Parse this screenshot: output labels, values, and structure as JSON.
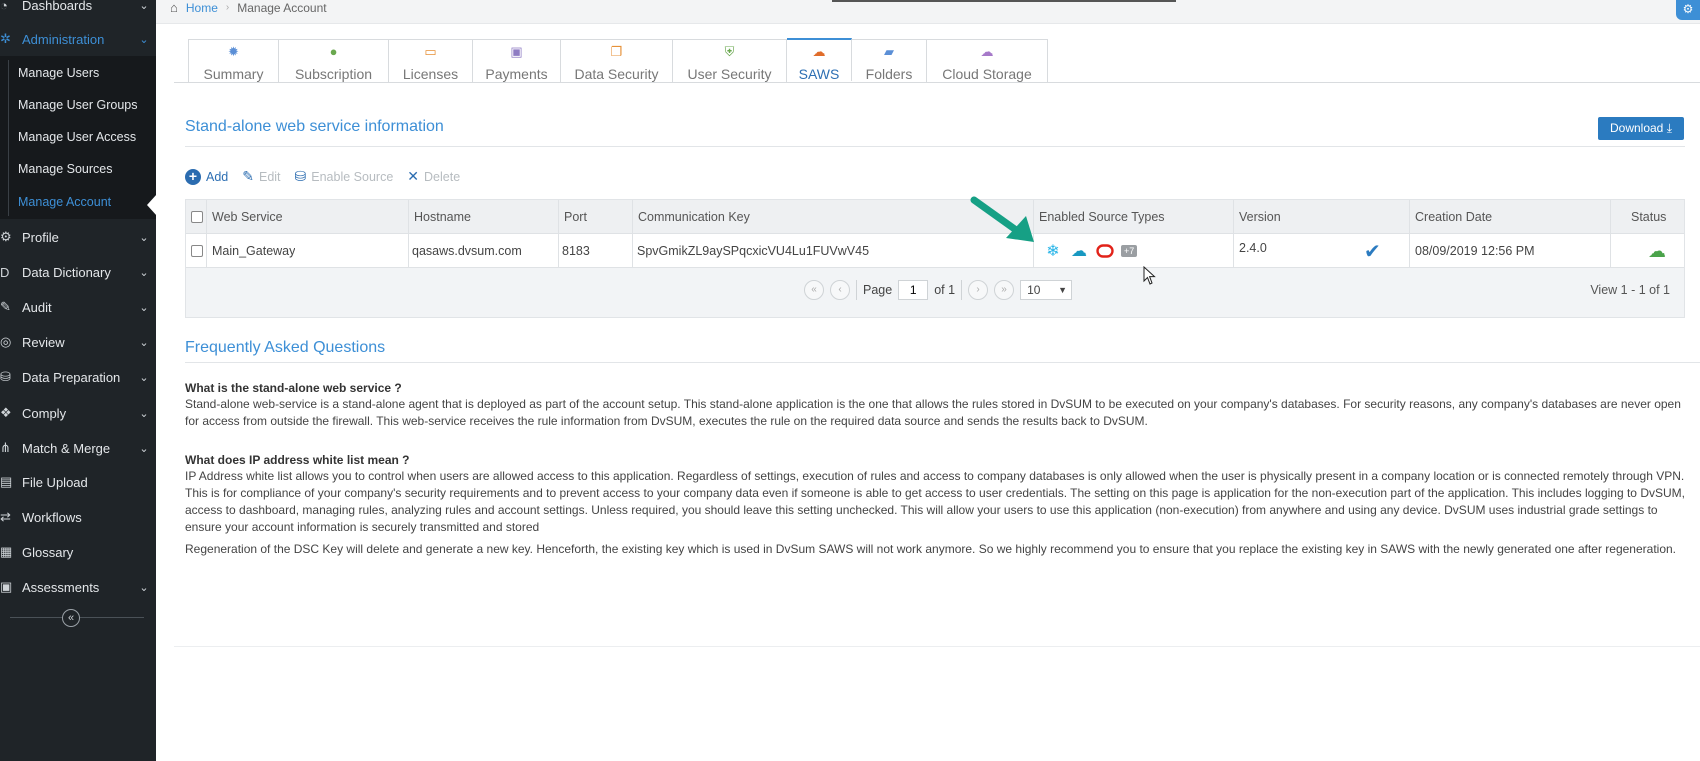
{
  "sidebar": {
    "items": [
      {
        "label": "Dashboards",
        "icon": "dashboard-icon"
      },
      {
        "label": "Administration",
        "icon": "network-icon"
      },
      {
        "label": "Profile",
        "icon": "gear-icon"
      },
      {
        "label": "Data Dictionary",
        "icon": "dictionary-icon"
      },
      {
        "label": "Audit",
        "icon": "pencil-icon"
      },
      {
        "label": "Review",
        "icon": "review-icon"
      },
      {
        "label": "Data Preparation",
        "icon": "database-icon"
      },
      {
        "label": "Comply",
        "icon": "comply-icon"
      },
      {
        "label": "Match & Merge",
        "icon": "merge-icon"
      },
      {
        "label": "File Upload",
        "icon": "file-upload-icon"
      },
      {
        "label": "Workflows",
        "icon": "workflow-icon"
      },
      {
        "label": "Glossary",
        "icon": "glossary-icon"
      },
      {
        "label": "Assessments",
        "icon": "assessment-icon"
      }
    ],
    "sub_items": [
      "Manage Users",
      "Manage User Groups",
      "Manage User Access",
      "Manage Sources",
      "Manage Account"
    ],
    "collapse_glyph": "«"
  },
  "breadcrumb": {
    "home": "Home",
    "current": "Manage Account"
  },
  "tabs": [
    {
      "label": "Summary",
      "icon": "summary-icon",
      "color": "#5b8fd6"
    },
    {
      "label": "Subscription",
      "icon": "user-icon",
      "color": "#6aa84f"
    },
    {
      "label": "Licenses",
      "icon": "license-icon",
      "color": "#e69138"
    },
    {
      "label": "Payments",
      "icon": "payment-icon",
      "color": "#8e7cc3"
    },
    {
      "label": "Data Security",
      "icon": "copy-icon",
      "color": "#e69138"
    },
    {
      "label": "User Security",
      "icon": "shield-icon",
      "color": "#6aa84f"
    },
    {
      "label": "SAWS",
      "icon": "cloud-gear-icon",
      "color": "#e06c2a"
    },
    {
      "label": "Folders",
      "icon": "folder-icon",
      "color": "#5b8fd6"
    },
    {
      "label": "Cloud Storage",
      "icon": "cloud-icon",
      "color": "#a679c9"
    }
  ],
  "section": {
    "title": "Stand-alone web service information",
    "download_label": "Download"
  },
  "toolbar": {
    "add": "Add",
    "edit": "Edit",
    "enable_source": "Enable Source",
    "delete": "Delete"
  },
  "table": {
    "headers": [
      "Web Service",
      "Hostname",
      "Port",
      "Communication Key",
      "Enabled Source Types",
      "Version",
      "Creation Date",
      "Status"
    ],
    "rows": [
      {
        "web_service": "Main_Gateway",
        "hostname": "qasaws.dvsum.com",
        "port": "8183",
        "key": "SpvGmikZL9aySPqcxicVU4Lu1FUVwV45",
        "sources": [
          "snowflake-icon",
          "salesforce-icon",
          "oracle-icon"
        ],
        "more": "+7",
        "version": "2.4.0",
        "creation_date": "08/09/2019 12:56 PM",
        "status": "cloud-gear-icon"
      }
    ]
  },
  "pager": {
    "page_label": "Page",
    "page_value": "1",
    "of_label": "of 1",
    "page_size": "10",
    "view": "View 1 - 1 of 1"
  },
  "faq": {
    "title": "Frequently Asked Questions",
    "q1": "What is the stand-alone web service ?",
    "a1": "Stand-alone web-service is a stand-alone agent that is deployed as part of the account setup. This stand-alone application is the one that allows the rules stored in DvSUM to be executed on your company's databases. For security reasons, any company's databases are never open for access from outside the firewall. This web-service receives the rule information from DvSUM, executes the rule on the required data source and sends the results back to DvSUM.",
    "q2": "What does IP address white list mean ?",
    "a2": "IP Address white list allows you to control when users are allowed access to this application. Regardless of settings, execution of rules and access to company databases is only allowed when the user is physically present in a company location or is connected remotely through VPN. This is for compliance of your company's security requirements and to prevent access to your company data even if someone is able to get access to user credentials. The setting on this page is application for the non-execution part of the application. This includes logging to DvSUM, access to dashboard, managing rules, analyzing rules and account settings. Unless required, you should leave this setting unchecked. This will allow your users to use this application (non-execution) from anywhere and using any device. DvSUM uses industrial grade settings to ensure your account information is securely transmitted and stored",
    "a3": "Regeneration of the DSC Key will delete and generate a new key. Henceforth, the existing key which is used in DvSum SAWS will not work anymore. So we highly recommend you to ensure that you replace the existing key in SAWS with the newly generated one after regeneration."
  },
  "colors": {
    "accent": "#3d8fd6",
    "sidebar_bg": "#1f2428",
    "arrow": "#16a085"
  }
}
